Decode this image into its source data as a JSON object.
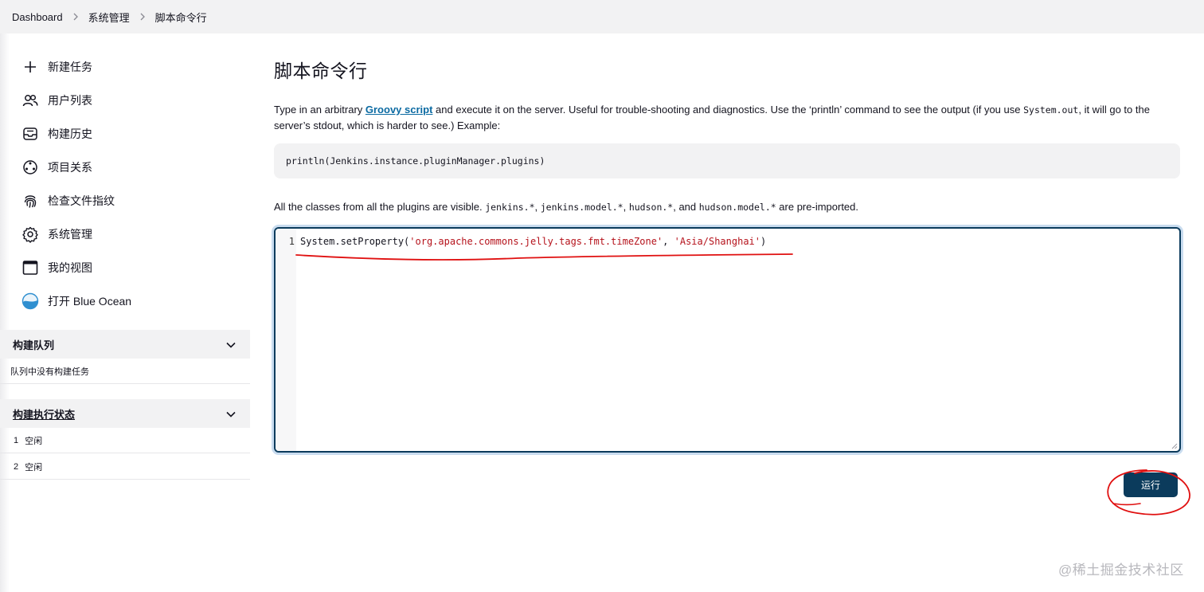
{
  "breadcrumb": {
    "items": [
      "Dashboard",
      "系统管理",
      "脚本命令行"
    ]
  },
  "sidebar": {
    "tasks": [
      {
        "label": "新建任务",
        "icon": "plus-icon"
      },
      {
        "label": "用户列表",
        "icon": "people-icon"
      },
      {
        "label": "构建历史",
        "icon": "inbox-icon"
      },
      {
        "label": "项目关系",
        "icon": "relationship-icon"
      },
      {
        "label": "检查文件指纹",
        "icon": "fingerprint-icon"
      },
      {
        "label": "系统管理",
        "icon": "gear-icon"
      },
      {
        "label": "我的视图",
        "icon": "window-icon"
      },
      {
        "label": "打开 Blue Ocean",
        "icon": "blue-ocean-icon"
      }
    ],
    "build_queue": {
      "title": "构建队列",
      "empty_text": "队列中没有构建任务"
    },
    "executors": {
      "title": "构建执行状态",
      "rows": [
        {
          "num": "1",
          "status": "空闲"
        },
        {
          "num": "2",
          "status": "空闲"
        }
      ]
    }
  },
  "main": {
    "title": "脚本命令行",
    "desc_part1": "Type in an arbitrary ",
    "desc_link": "Groovy script",
    "desc_part2": " and execute it on the server. Useful for trouble-shooting and diagnostics. Use the ‘println’ command to see the output (if you use ",
    "desc_code": "System.out",
    "desc_part3": ", it will go to the server’s stdout, which is harder to see.) Example:",
    "example_code": "println(Jenkins.instance.pluginManager.plugins)",
    "classes_part1": "All the classes from all the plugins are visible. ",
    "classes_code1": "jenkins.*",
    "classes_sep1": ", ",
    "classes_code2": "jenkins.model.*",
    "classes_sep2": ", ",
    "classes_code3": "hudson.*",
    "classes_sep3": ", and ",
    "classes_code4": "hudson.model.*",
    "classes_part2": " are pre-imported.",
    "editor": {
      "line_number": "1",
      "code_prefix": "System.setProperty(",
      "code_arg1": "'org.apache.commons.jelly.tags.fmt.timeZone'",
      "code_comma": ", ",
      "code_arg2": "'Asia/Shanghai'",
      "code_suffix": ")"
    },
    "run_label": "运行"
  },
  "watermark": "@稀土掘金技术社区",
  "colors": {
    "accent": "#0b3b5c",
    "link": "#0b6aa2",
    "string": "#b5121b",
    "annotation": "#e01010"
  }
}
